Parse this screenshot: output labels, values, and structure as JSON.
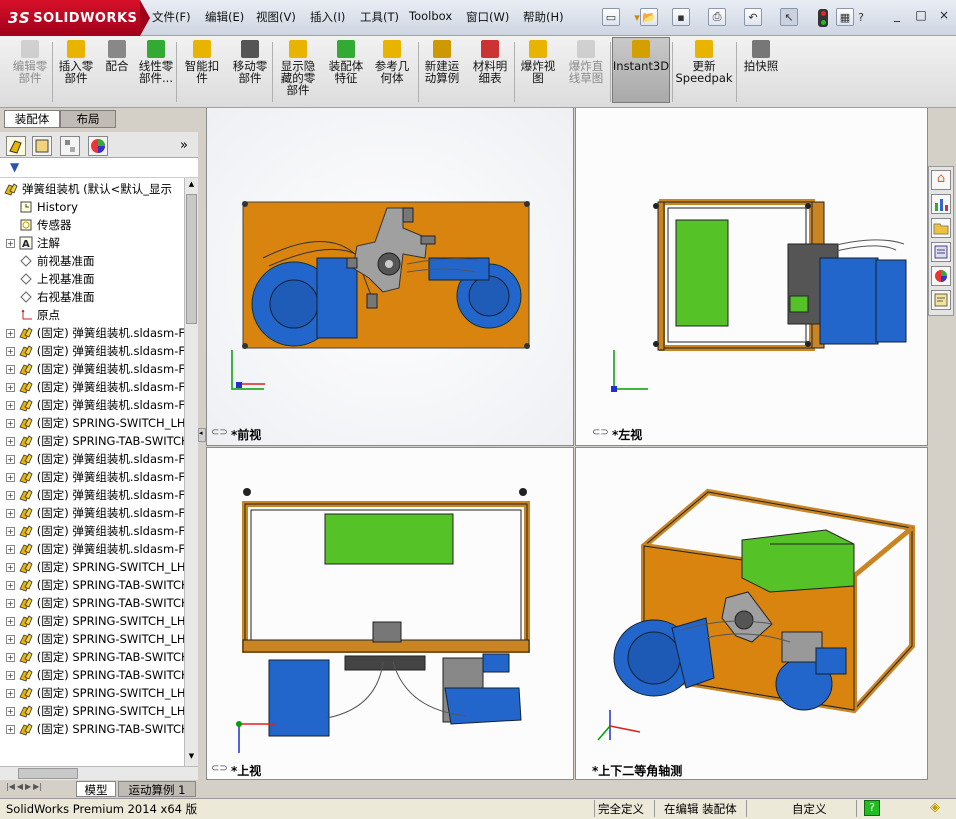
{
  "app": {
    "logo": "SOLIDWORKS",
    "logo_prefix": "3S"
  },
  "menu": [
    "文件(F)",
    "编辑(E)",
    "视图(V)",
    "插入(I)",
    "工具(T)",
    "Toolbox",
    "窗口(W)",
    "帮助(H)"
  ],
  "window_buttons": [
    "_",
    "□",
    "×"
  ],
  "commands": [
    {
      "label": "编辑零\n部件",
      "enabled": false
    },
    {
      "label": "插入零\n部件",
      "enabled": true
    },
    {
      "label": "配合",
      "enabled": true
    },
    {
      "label": "线性零\n部件...",
      "enabled": true
    },
    {
      "label": "智能扣\n件",
      "enabled": true
    },
    {
      "label": "移动零\n部件",
      "enabled": true
    },
    {
      "label": "显示隐\n藏的零\n部件",
      "enabled": true
    },
    {
      "label": "装配体\n特征",
      "enabled": true
    },
    {
      "label": "参考几\n何体",
      "enabled": true
    },
    {
      "label": "新建运\n动算例",
      "enabled": true
    },
    {
      "label": "材料明\n细表",
      "enabled": true
    },
    {
      "label": "爆炸视\n图",
      "enabled": true
    },
    {
      "label": "爆炸直\n线草图",
      "enabled": false
    },
    {
      "label": "Instant3D",
      "enabled": true
    },
    {
      "label": "更新\nSpeedpak",
      "enabled": true
    },
    {
      "label": "拍快照",
      "enabled": true
    }
  ],
  "panel_tabs": [
    "装配体",
    "布局"
  ],
  "tree": {
    "root": "弹簧组装机 (默认<默认_显示",
    "items": [
      {
        "label": "History",
        "icon": "history-icon",
        "exp": false
      },
      {
        "label": "传感器",
        "icon": "sensor-icon",
        "exp": false
      },
      {
        "label": "注解",
        "icon": "annotation-icon",
        "exp": true
      },
      {
        "label": "前视基准面",
        "icon": "plane-icon",
        "exp": false
      },
      {
        "label": "上视基准面",
        "icon": "plane-icon",
        "exp": false
      },
      {
        "label": "右视基准面",
        "icon": "plane-icon",
        "exp": false
      },
      {
        "label": "原点",
        "icon": "origin-icon",
        "exp": false
      },
      {
        "label": "(固定) 弹簧组装机.sldasm-F",
        "icon": "part-icon",
        "exp": true
      },
      {
        "label": "(固定) 弹簧组装机.sldasm-F",
        "icon": "part-icon",
        "exp": true
      },
      {
        "label": "(固定) 弹簧组装机.sldasm-F",
        "icon": "part-icon",
        "exp": true
      },
      {
        "label": "(固定) 弹簧组装机.sldasm-F",
        "icon": "part-icon",
        "exp": true
      },
      {
        "label": "(固定) 弹簧组装机.sldasm-F",
        "icon": "part-icon",
        "exp": true
      },
      {
        "label": "(固定) SPRING-SWITCH_LH_",
        "icon": "part-icon",
        "exp": true
      },
      {
        "label": "(固定) SPRING-TAB-SWITCH",
        "icon": "part-icon",
        "exp": true
      },
      {
        "label": "(固定) 弹簧组装机.sldasm-F",
        "icon": "part-icon",
        "exp": true
      },
      {
        "label": "(固定) 弹簧组装机.sldasm-F",
        "icon": "part-icon",
        "exp": true
      },
      {
        "label": "(固定) 弹簧组装机.sldasm-F",
        "icon": "part-icon",
        "exp": true
      },
      {
        "label": "(固定) 弹簧组装机.sldasm-F",
        "icon": "part-icon",
        "exp": true
      },
      {
        "label": "(固定) 弹簧组装机.sldasm-F",
        "icon": "part-icon",
        "exp": true
      },
      {
        "label": "(固定) 弹簧组装机.sldasm-F",
        "icon": "part-icon",
        "exp": true
      },
      {
        "label": "(固定) SPRING-SWITCH_LH_",
        "icon": "part-icon",
        "exp": true
      },
      {
        "label": "(固定) SPRING-TAB-SWITCH",
        "icon": "part-icon",
        "exp": true
      },
      {
        "label": "(固定) SPRING-TAB-SWITCH",
        "icon": "part-icon",
        "exp": true
      },
      {
        "label": "(固定) SPRING-SWITCH_LH_",
        "icon": "part-icon",
        "exp": true
      },
      {
        "label": "(固定) SPRING-SWITCH_LH_",
        "icon": "part-icon",
        "exp": true
      },
      {
        "label": "(固定) SPRING-TAB-SWITCH",
        "icon": "part-icon",
        "exp": true
      },
      {
        "label": "(固定) SPRING-TAB-SWITCH",
        "icon": "part-icon",
        "exp": true
      },
      {
        "label": "(固定) SPRING-SWITCH_LH_",
        "icon": "part-icon",
        "exp": true
      },
      {
        "label": "(固定) SPRING-SWITCH_LH_",
        "icon": "part-icon",
        "exp": true
      },
      {
        "label": "(固定) SPRING-TAB-SWITCH",
        "icon": "part-icon",
        "exp": true
      }
    ]
  },
  "viewports": {
    "front": "*前视",
    "left": "*左视",
    "top": "*上视",
    "iso": "*上下二等角轴测"
  },
  "bottom_tabs": [
    "模型",
    "运动算例 1"
  ],
  "status": {
    "product": "SolidWorks Premium 2014 x64 版",
    "defined": "完全定义",
    "editing": "在编辑 装配体",
    "units": "自定义"
  },
  "colors": {
    "plate": "#d9840f",
    "blue": "#2266cc",
    "green": "#55c228",
    "frame": "#c98524"
  }
}
